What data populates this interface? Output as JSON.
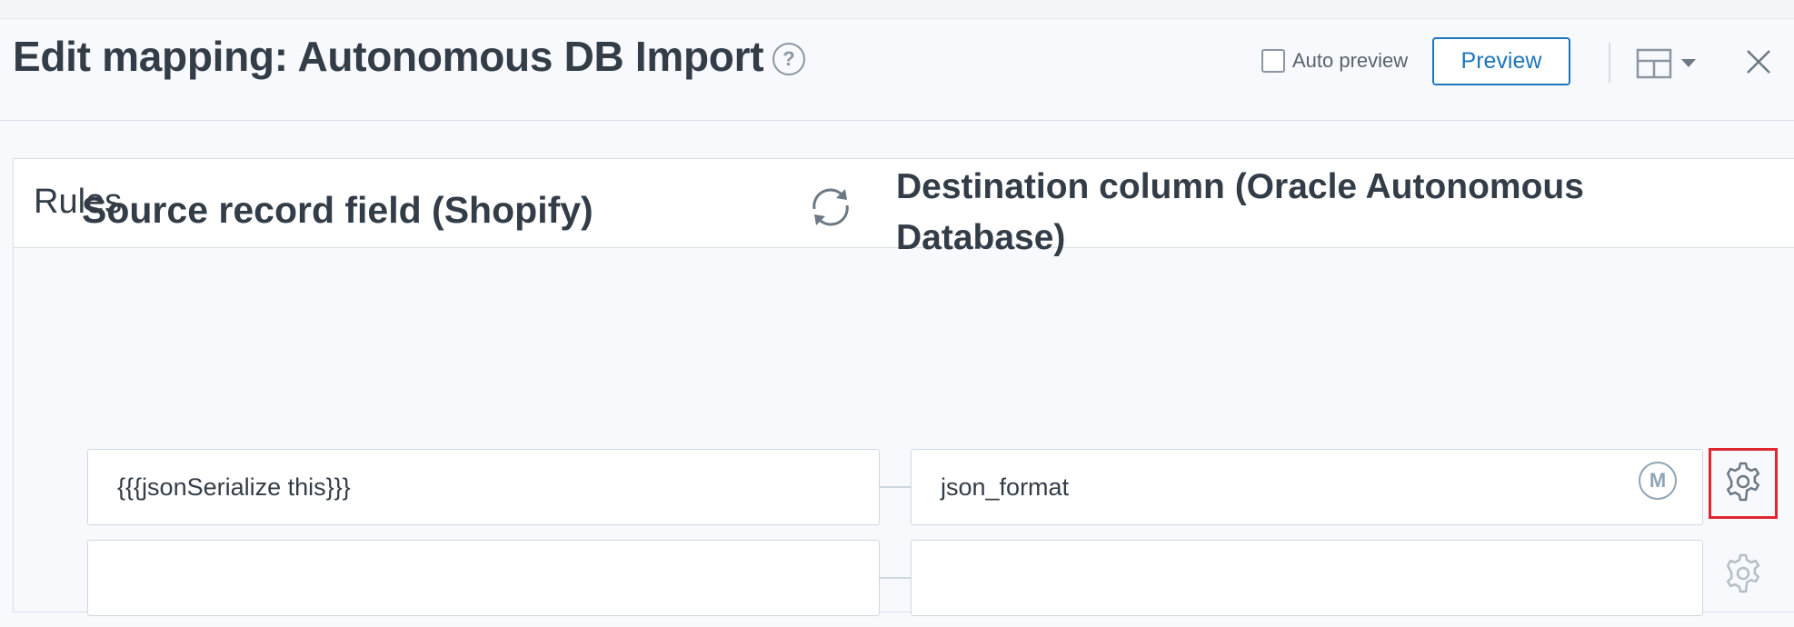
{
  "header": {
    "title": "Edit mapping: Autonomous DB Import",
    "help_icon": "?",
    "auto_preview_label": "Auto preview",
    "auto_preview_checked": false,
    "preview_button": "Preview"
  },
  "rules": {
    "title": "Rules",
    "source_column_header": "Source record field (Shopify)",
    "destination_column_header": "Destination column (Oracle Autonomous Database)",
    "rows": [
      {
        "source": "{{{jsonSerialize this}}}",
        "destination": "json_format",
        "badge": "M"
      },
      {
        "source": "",
        "destination": "",
        "badge": ""
      }
    ]
  },
  "colors": {
    "accent": "#1d76ba",
    "highlight": "#e0262f",
    "text": "#333d47",
    "border": "#cfd8e0"
  },
  "icons": [
    "help-icon",
    "layout-toggle-icon",
    "chevron-down-icon",
    "close-icon",
    "sync-icon",
    "gear-icon"
  ]
}
